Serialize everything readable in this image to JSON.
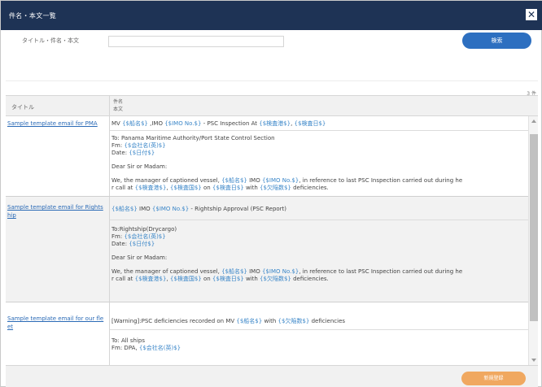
{
  "window": {
    "title": "件名・本文一覧",
    "close_glyph": "✕"
  },
  "search": {
    "label": "タイトル・件名・本文",
    "value": "",
    "placeholder": "",
    "button_label": "検索"
  },
  "result_count": "3 件",
  "table": {
    "col_title": "タイトル",
    "col_subject_line1": "件名",
    "col_subject_line2": "本文"
  },
  "rows": [
    {
      "title": "Sample template email for PMA",
      "subject_prefix": "MV ",
      "subject_ph1": "{$船名$}",
      "subject_mid": " ,IMO ",
      "subject_ph2": "{$IMO No.$}",
      "subject_tail": " - PSC Inspection At ",
      "subject_ph3": "{$検査港$}",
      "subject_sep": ", ",
      "subject_ph4": "{$検査日$}",
      "to": "To: Panama Maritime Authority/Port State Control Section",
      "fm_label": "Fm: ",
      "fm_ph": "{$会社名(英)$}",
      "date_label": "Date: ",
      "date_ph": "{$日付$}",
      "salutation": "Dear Sir or Madam:",
      "p1_a": "We, the manager of captioned vessel, ",
      "p1_ph1": "{$船名$}",
      "p1_b": " IMO ",
      "p1_ph2": "{$IMO No.$}",
      "p1_c": ", in reference to last PSC Inspection carried out during he",
      "p2_a": "r call at ",
      "p2_ph1": "{$検査港$}",
      "p2_b": ", ",
      "p2_ph2": "{$検査国$}",
      "p2_c": " on ",
      "p2_ph3": "{$検査日$}",
      "p2_d": " with ",
      "p2_ph4": "{$欠陥数$}",
      "p2_e": " deficiencies."
    },
    {
      "title": "Sample template email for Rightship",
      "subject_ph1": "{$船名$}",
      "subject_mid": " IMO ",
      "subject_ph2": "{$IMO No.$}",
      "subject_tail": " - Rightship Approval (PSC Report)",
      "to": "To:Rightship(Drycargo)",
      "fm_label": "Fm: ",
      "fm_ph": "{$会社名(英)$}",
      "date_label": "Date: ",
      "date_ph": "{$日付$}",
      "salutation": "Dear Sir or Madam:",
      "p1_a": "We, the manager of captioned vessel, ",
      "p1_ph1": "{$船名$}",
      "p1_b": " IMO ",
      "p1_ph2": "{$IMO No.$}",
      "p1_c": ", in reference to last PSC Inspection carried out during he",
      "p2_a": "r call at ",
      "p2_ph1": "{$検査港$}",
      "p2_b": ", ",
      "p2_ph2": "{$検査国$}",
      "p2_c": " on ",
      "p2_ph3": "{$検査日$}",
      "p2_d": " with ",
      "p2_ph4": "{$欠陥数$}",
      "p2_e": " deficiencies."
    },
    {
      "title": "Sample template email for our fleet",
      "subject_a": "[Warning]:PSC deficiencies recorded on MV ",
      "subject_ph1": "{$船名$}",
      "subject_b": " with ",
      "subject_ph2": "{$欠陥数$}",
      "subject_c": " deficiencies",
      "to": "To: All ships",
      "fm_label": "Fm: DPA, ",
      "fm_ph": "{$会社名(英)$}"
    }
  ],
  "footer": {
    "button_label": "新規登録"
  },
  "colors": {
    "titlebar": "#1e3355",
    "search_button": "#2d6fc0",
    "register_button": "#f0a860",
    "link": "#2a6ab6",
    "placeholder": "#3a86c8"
  }
}
